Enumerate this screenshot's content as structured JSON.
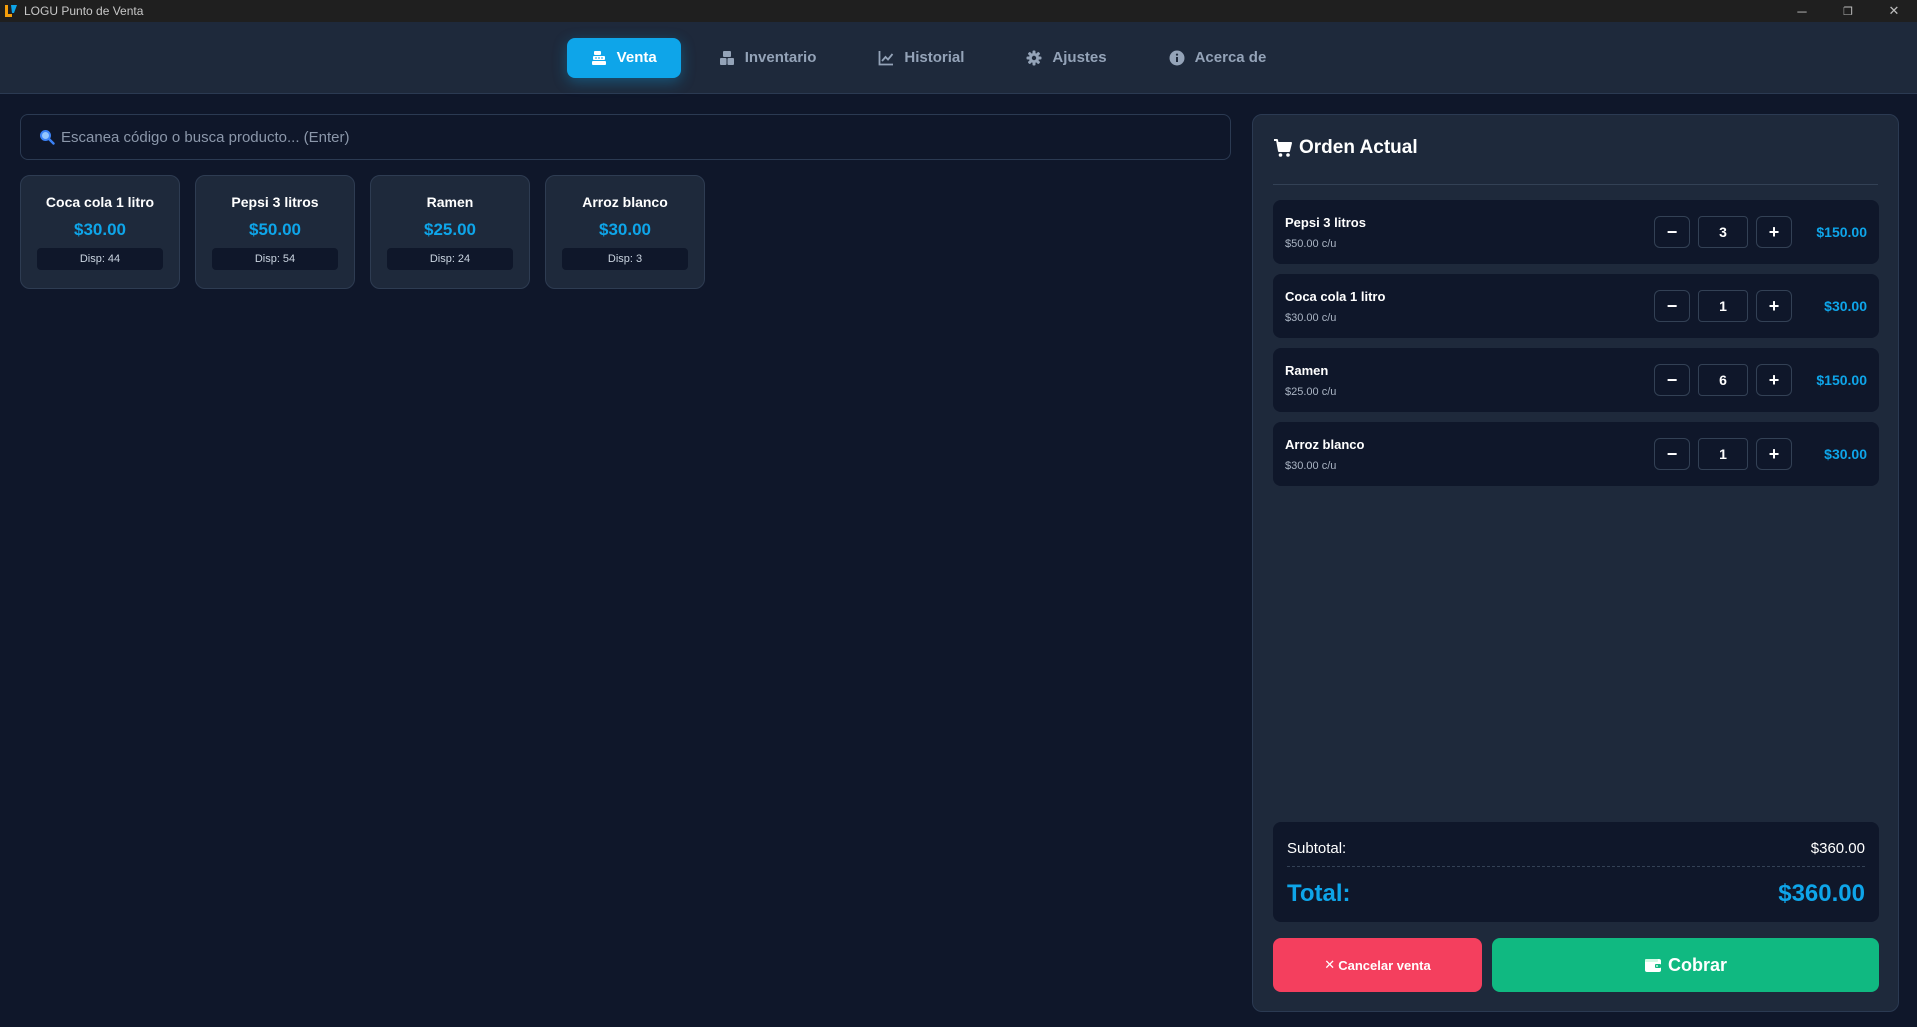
{
  "window": {
    "title": "LOGU Punto de Venta",
    "controls": {
      "minimize": "─",
      "maximize": "❐",
      "close": "✕"
    }
  },
  "nav": {
    "tabs": [
      {
        "label": "Venta",
        "icon": "cash-register-icon",
        "active": true
      },
      {
        "label": "Inventario",
        "icon": "boxes-icon",
        "active": false
      },
      {
        "label": "Historial",
        "icon": "chart-line-icon",
        "active": false
      },
      {
        "label": "Ajustes",
        "icon": "gear-icon",
        "active": false
      },
      {
        "label": "Acerca de",
        "icon": "info-circle-icon",
        "active": false
      }
    ]
  },
  "search": {
    "placeholder": "Escanea código o busca producto... (Enter)",
    "value": ""
  },
  "products": [
    {
      "name": "Coca cola 1 litro",
      "price": "$30.00",
      "stock": "Disp: 44"
    },
    {
      "name": "Pepsi 3 litros",
      "price": "$50.00",
      "stock": "Disp: 54"
    },
    {
      "name": "Ramen",
      "price": "$25.00",
      "stock": "Disp: 24"
    },
    {
      "name": "Arroz blanco",
      "price": "$30.00",
      "stock": "Disp: 3"
    }
  ],
  "order": {
    "title": "Orden Actual",
    "items": [
      {
        "name": "Pepsi 3 litros",
        "unit_price": "$50.00 c/u",
        "qty": "3",
        "total": "$150.00"
      },
      {
        "name": "Coca cola 1 litro",
        "unit_price": "$30.00 c/u",
        "qty": "1",
        "total": "$30.00"
      },
      {
        "name": "Ramen",
        "unit_price": "$25.00 c/u",
        "qty": "6",
        "total": "$150.00"
      },
      {
        "name": "Arroz blanco",
        "unit_price": "$30.00 c/u",
        "qty": "1",
        "total": "$30.00"
      }
    ],
    "decrement_label": "−",
    "increment_label": "+",
    "subtotal_label": "Subtotal:",
    "subtotal_value": "$360.00",
    "total_label": "Total:",
    "total_value": "$360.00",
    "cancel_label": "Cancelar venta",
    "cancel_symbol": "✕",
    "pay_label": "Cobrar"
  },
  "colors": {
    "accent": "#0ea5e9",
    "background": "#0f172a",
    "panel": "#1e293b",
    "cancel": "#f43f5e",
    "pay": "#10b981"
  }
}
